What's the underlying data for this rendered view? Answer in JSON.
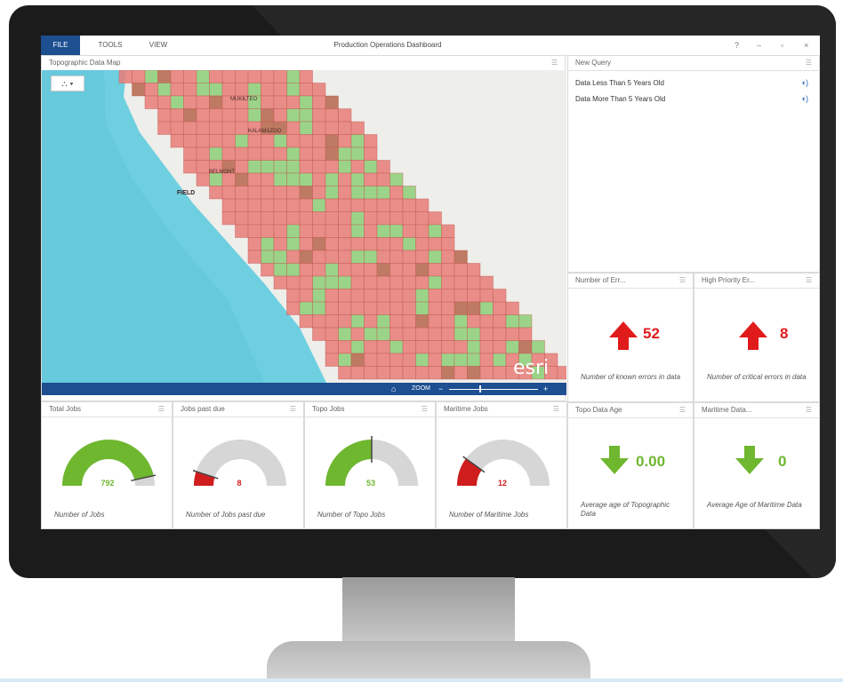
{
  "window": {
    "menu": [
      "FILE",
      "TOOLS",
      "VIEW"
    ],
    "title": "Production Operations Dashboard",
    "controls": [
      "?",
      "–",
      "▫",
      "×"
    ]
  },
  "map_panel": {
    "title": "Topographic Data Map",
    "place_labels": [
      "MUKILTEO",
      "KALAMAZOO",
      "BELMONT",
      "FIELD"
    ],
    "zoom_label": "ZOOM",
    "logo": "esri"
  },
  "query_panel": {
    "title": "New Query",
    "items": [
      "Data Less Than 5 Years Old",
      "Data More Than 5 Years Old"
    ]
  },
  "indicators": [
    {
      "title": "Number of Err...",
      "value": "52",
      "trend": "up",
      "color": "#e01b1b",
      "description": "Number of known errors in data"
    },
    {
      "title": "High Priority Er...",
      "value": "8",
      "trend": "up",
      "color": "#e01b1b",
      "description": "Number of critical errors in data"
    },
    {
      "title": "Topo Data Age",
      "value": "0.00",
      "trend": "down",
      "color": "#6fb72f",
      "description": "Average age of Topographic Data"
    },
    {
      "title": "Maritime Data...",
      "value": "0",
      "trend": "down",
      "color": "#6fb72f",
      "description": "Average Age of Maritime Data"
    }
  ],
  "gauges": [
    {
      "title": "Total Jobs",
      "value": "792",
      "fraction": 0.93,
      "color": "#6fb72f",
      "description": "Number of Jobs"
    },
    {
      "title": "Jobs past due",
      "value": "8",
      "fraction": 0.1,
      "color": "#d01d1d",
      "description": "Number of Jobs past due"
    },
    {
      "title": "Topo Jobs",
      "value": "53",
      "fraction": 0.5,
      "color": "#6fb72f",
      "description": "Number of Topo Jobs"
    },
    {
      "title": "Maritime Jobs",
      "value": "12",
      "fraction": 0.2,
      "color": "#d01d1d",
      "description": "Number of Maritime Jobs"
    }
  ],
  "colors": {
    "accent": "#1d4f91",
    "good": "#6fb72f",
    "bad": "#e01b1b",
    "water": "#6ecfe0"
  }
}
